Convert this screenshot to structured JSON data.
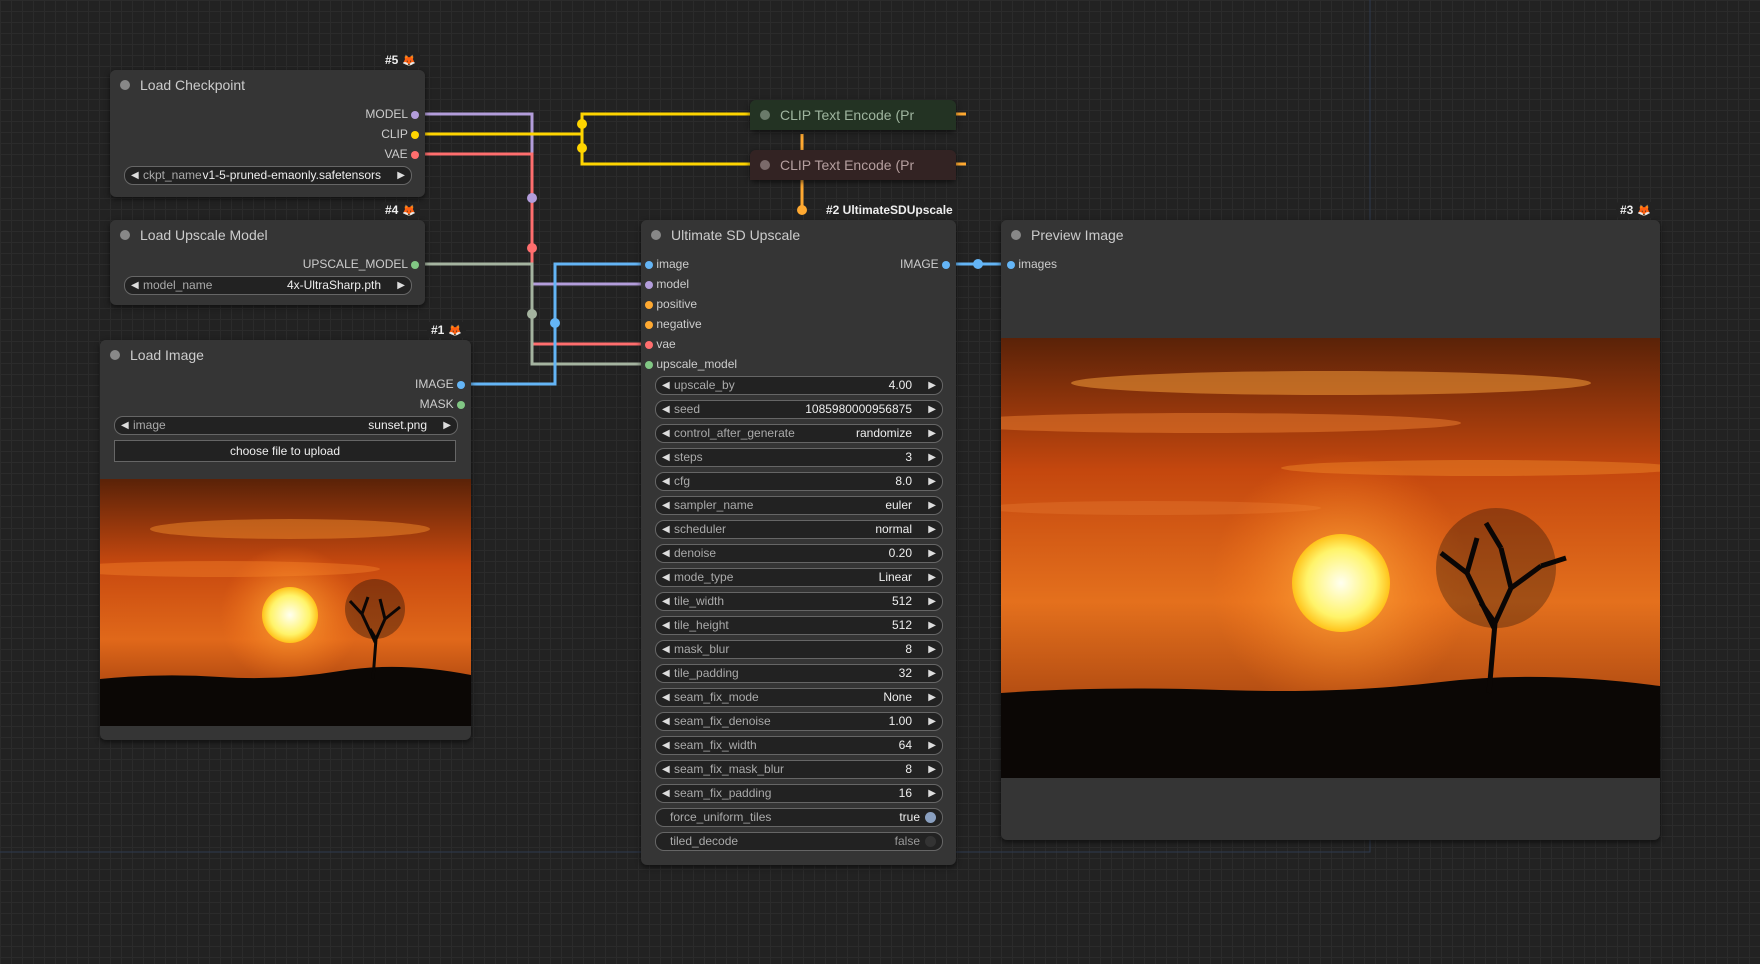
{
  "colors": {
    "model": "#b39ddb",
    "clip": "#ffd500",
    "vae": "#ff6e6e",
    "image": "#64b5f6",
    "mask": "#81c784",
    "upscale_model": "#a5b4a0",
    "conditioning": "#ffa931"
  },
  "nodes": {
    "load_checkpoint": {
      "badge": "#5",
      "title": "Load Checkpoint",
      "outputs": [
        "MODEL",
        "CLIP",
        "VAE"
      ],
      "widgets": [
        {
          "label": "ckpt_name",
          "value": "v1-5-pruned-emaonly.safetensors"
        }
      ]
    },
    "load_upscale_model": {
      "badge": "#4",
      "title": "Load Upscale Model",
      "outputs": [
        "UPSCALE_MODEL"
      ],
      "widgets": [
        {
          "label": "model_name",
          "value": "4x-UltraSharp.pth"
        }
      ]
    },
    "load_image": {
      "badge": "#1",
      "title": "Load Image",
      "outputs": [
        "IMAGE",
        "MASK"
      ],
      "widgets": [
        {
          "label": "image",
          "value": "sunset.png"
        }
      ],
      "upload_label": "choose file to upload"
    },
    "clip_pos": {
      "title": "CLIP Text Encode (Pr"
    },
    "clip_neg": {
      "title": "CLIP Text Encode (Pr"
    },
    "ultimate": {
      "badge": "#2 UltimateSDUpscale",
      "title": "Ultimate SD Upscale",
      "inputs": [
        "image",
        "model",
        "positive",
        "negative",
        "vae",
        "upscale_model"
      ],
      "outputs": [
        "IMAGE"
      ],
      "widgets": [
        {
          "label": "upscale_by",
          "value": "4.00"
        },
        {
          "label": "seed",
          "value": "1085980000956875"
        },
        {
          "label": "control_after_generate",
          "value": "randomize"
        },
        {
          "label": "steps",
          "value": "3"
        },
        {
          "label": "cfg",
          "value": "8.0"
        },
        {
          "label": "sampler_name",
          "value": "euler"
        },
        {
          "label": "scheduler",
          "value": "normal"
        },
        {
          "label": "denoise",
          "value": "0.20"
        },
        {
          "label": "mode_type",
          "value": "Linear"
        },
        {
          "label": "tile_width",
          "value": "512"
        },
        {
          "label": "tile_height",
          "value": "512"
        },
        {
          "label": "mask_blur",
          "value": "8"
        },
        {
          "label": "tile_padding",
          "value": "32"
        },
        {
          "label": "seam_fix_mode",
          "value": "None"
        },
        {
          "label": "seam_fix_denoise",
          "value": "1.00"
        },
        {
          "label": "seam_fix_width",
          "value": "64"
        },
        {
          "label": "seam_fix_mask_blur",
          "value": "8"
        },
        {
          "label": "seam_fix_padding",
          "value": "16"
        }
      ],
      "toggles": [
        {
          "label": "force_uniform_tiles",
          "value": "true"
        },
        {
          "label": "tiled_decode",
          "value": "false"
        }
      ]
    },
    "preview": {
      "badge": "#3",
      "title": "Preview Image",
      "inputs": [
        "images"
      ]
    }
  }
}
